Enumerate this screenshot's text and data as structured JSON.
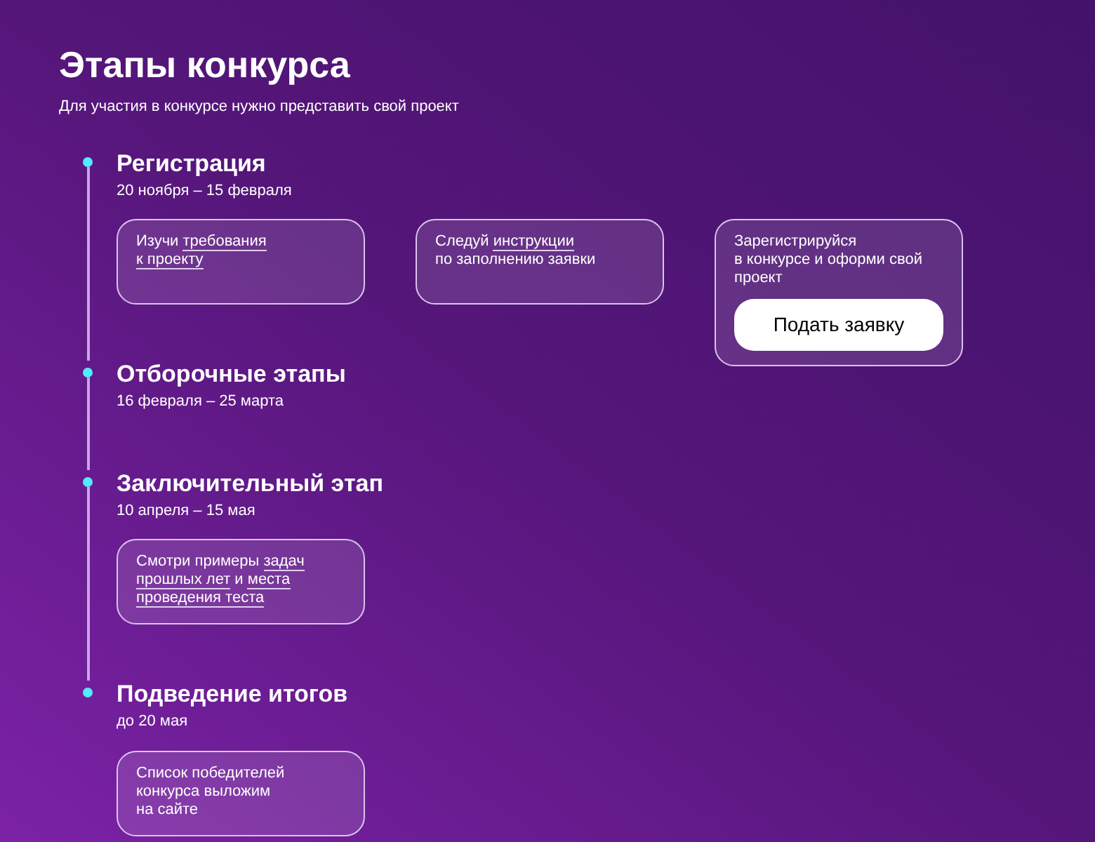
{
  "title": "Этапы конкурса",
  "subtitle": "Для участия в конкурсе нужно представить свой проект",
  "stages": [
    {
      "name": "Регистрация",
      "dates": "20 ноября – 15 февраля",
      "cards": [
        {
          "lines": [
            [
              {
                "text": "Изучи "
              },
              {
                "text": "требования",
                "link": true
              }
            ],
            [
              {
                "text": "к проекту",
                "link": true
              }
            ]
          ]
        },
        {
          "lines": [
            [
              {
                "text": "Следуй "
              },
              {
                "text": "инструкции",
                "link": true
              }
            ],
            [
              {
                "text": "по заполнению заявки"
              }
            ]
          ]
        },
        {
          "lines": [
            [
              {
                "text": "Зарегистрируйся"
              }
            ],
            [
              {
                "text": "в конкурсе и оформи свой"
              }
            ],
            [
              {
                "text": "проект"
              }
            ]
          ],
          "button": "Подать заявку"
        }
      ]
    },
    {
      "name": "Отборочные этапы",
      "dates": "16 февраля – 25 марта"
    },
    {
      "name": "Заключительный этап",
      "dates": "10 апреля – 15 мая",
      "cards": [
        {
          "lines": [
            [
              {
                "text": "Смотри примеры "
              },
              {
                "text": "задач",
                "link": true
              }
            ],
            [
              {
                "text": "прошлых лет",
                "link": true
              },
              {
                "text": " и "
              },
              {
                "text": "места",
                "link": true
              }
            ],
            [
              {
                "text": "проведения теста",
                "link": true
              }
            ]
          ]
        }
      ]
    },
    {
      "name": "Подведение итогов",
      "dates": "до 20 мая",
      "cards": [
        {
          "lines": [
            [
              {
                "text": "Список победителей"
              }
            ],
            [
              {
                "text": "конкурса выложим"
              }
            ],
            [
              {
                "text": "на сайте"
              }
            ]
          ]
        }
      ]
    }
  ]
}
